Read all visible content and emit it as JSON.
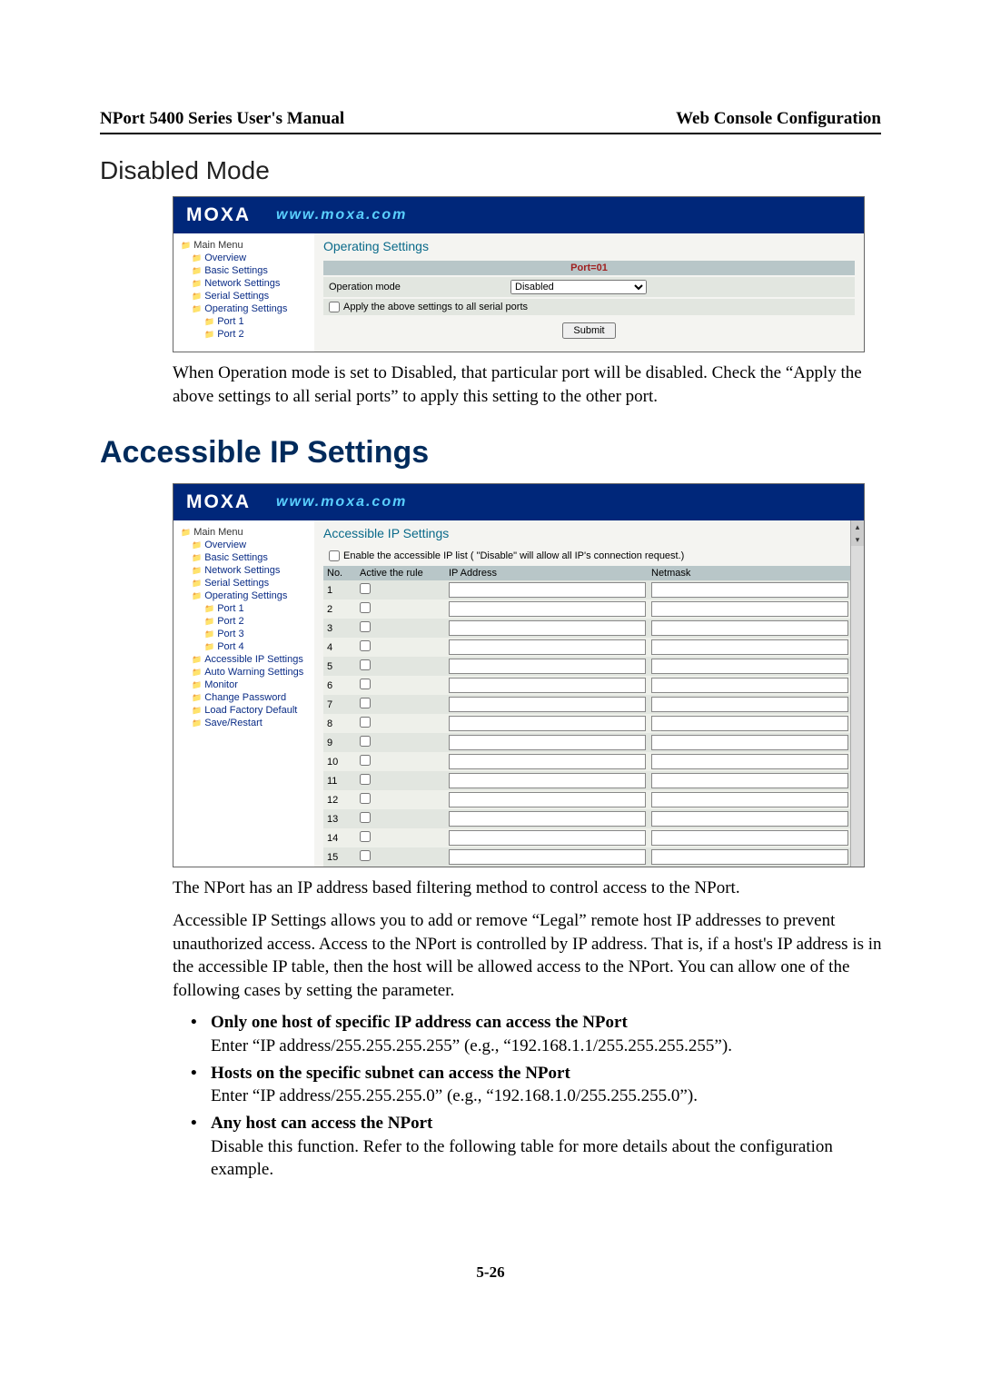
{
  "header": {
    "left": "NPort 5400 Series User's Manual",
    "right": "Web Console Configuration"
  },
  "section_title": "Disabled Mode",
  "main_heading": "Accessible IP Settings",
  "page_number": "5-26",
  "moxa": {
    "logo": "MOXA",
    "url": "www.moxa.com"
  },
  "shot1": {
    "tree_root": "Main Menu",
    "tree": [
      "Overview",
      "Basic Settings",
      "Network Settings",
      "Serial Settings",
      "Operating Settings",
      "Port 1",
      "Port 2"
    ],
    "pane_title": "Operating Settings",
    "port_hdr": "Port=01",
    "opmode_lbl": "Operation mode",
    "opmode_val": "Disabled",
    "apply_chk": "Apply the above settings to all serial ports",
    "submit": "Submit"
  },
  "para1": "When Operation mode is set to Disabled, that particular port will be disabled. Check the “Apply the above settings to all serial ports” to apply this setting to the other port.",
  "shot2": {
    "tree_root": "Main Menu",
    "tree": [
      "Overview",
      "Basic Settings",
      "Network Settings",
      "Serial Settings",
      "Operating Settings",
      "Port 1",
      "Port 2",
      "Port 3",
      "Port 4",
      "Accessible IP Settings",
      "Auto Warning Settings",
      "Monitor",
      "Change Password",
      "Load Factory Default",
      "Save/Restart"
    ],
    "pane_title": "Accessible IP Settings",
    "enable_lbl": "Enable the accessible IP list ( \"Disable\" will allow all IP's connection request.)",
    "th_no": "No.",
    "th_active": "Active the rule",
    "th_ip": "IP Address",
    "th_mask": "Netmask",
    "rows": 15
  },
  "para2": "The NPort has an IP address based filtering method to control access to the NPort.",
  "para3": "Accessible IP Settings allows you to add or remove “Legal” remote host IP addresses to prevent unauthorized access. Access to the NPort is controlled by IP address. That is, if a host's IP address is in the accessible IP table, then the host will be allowed access to the NPort. You can allow one of the following cases by setting the parameter.",
  "bul1": {
    "title": "Only one host of specific IP address can access the NPort",
    "body": "Enter “IP address/255.255.255.255” (e.g., “192.168.1.1/255.255.255.255”)."
  },
  "bul2": {
    "title": "Hosts on the specific subnet can access the NPort",
    "body": "Enter “IP address/255.255.255.0” (e.g., “192.168.1.0/255.255.255.0”)."
  },
  "bul3": {
    "title": "Any host can access the NPort",
    "body": "Disable this function. Refer to the following table for more details about the configuration example."
  }
}
